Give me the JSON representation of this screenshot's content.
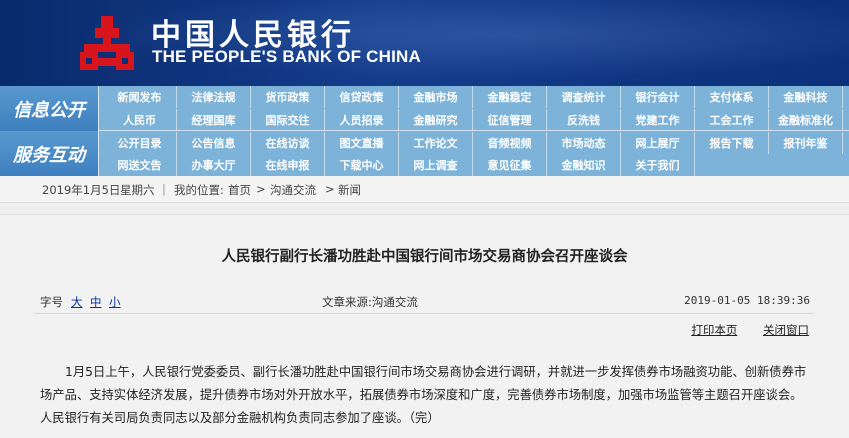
{
  "header": {
    "brand_cn": "中国人民银行",
    "brand_en": "THE PEOPLE'S BANK OF CHINA",
    "logo": "pboc-emblem-icon",
    "colors": {
      "banner": "#0a2f78",
      "emblem": "#d8151d"
    }
  },
  "nav": {
    "group1_label": "信息公开",
    "group2_label": "服务互动",
    "row1": [
      "新闻发布",
      "法律法规",
      "货币政策",
      "信贷政策",
      "金融市场",
      "金融稳定",
      "调查统计",
      "银行会计",
      "支付体系",
      "金融科技"
    ],
    "row2": [
      "人民币",
      "经理国库",
      "国际交往",
      "人员招录",
      "金融研究",
      "征信管理",
      "反洗钱",
      "党建工作",
      "工会工作",
      "金融标准化"
    ],
    "row3": [
      "公开目录",
      "公告信息",
      "在线访谈",
      "图文直播",
      "工作论文",
      "音频视频",
      "市场动态",
      "网上展厅",
      "报告下载",
      "报刊年鉴"
    ],
    "row4": [
      "网送文告",
      "办事大厅",
      "在线申报",
      "下载中心",
      "网上调查",
      "意见征集",
      "金融知识",
      "关于我们"
    ],
    "colors": {
      "bar": "#7db3d8",
      "label_bg": "#3d7fbf"
    }
  },
  "breadcrumb": {
    "date": "2019年1月5日",
    "weekday": "星期六",
    "location_label": "我的位置:",
    "home": "首页",
    "sep1": ">",
    "section": "沟通交流",
    "sep2": ">",
    "current": "新闻",
    "divider": "|"
  },
  "article": {
    "title": "人民银行副行长潘功胜赴中国银行间市场交易商协会召开座谈会",
    "font_size_label": "字号",
    "font_sizes": [
      "大",
      "中",
      "小"
    ],
    "source_label": "文章来源:",
    "source": "沟通交流",
    "timestamp": "2019-01-05 18:39:36",
    "print_label": "打印本页",
    "close_label": "关闭窗口",
    "body": "1月5日上午，人民银行党委委员、副行长潘功胜赴中国银行间市场交易商协会进行调研，并就进一步发挥债券市场融资功能、创新债券市场产品、支持实体经济发展，提升债券市场对外开放水平，拓展债券市场深度和广度，完善债券市场制度，加强市场监管等主题召开座谈会。人民银行有关司局负责同志以及部分金融机构负责同志参加了座谈。（完）"
  }
}
